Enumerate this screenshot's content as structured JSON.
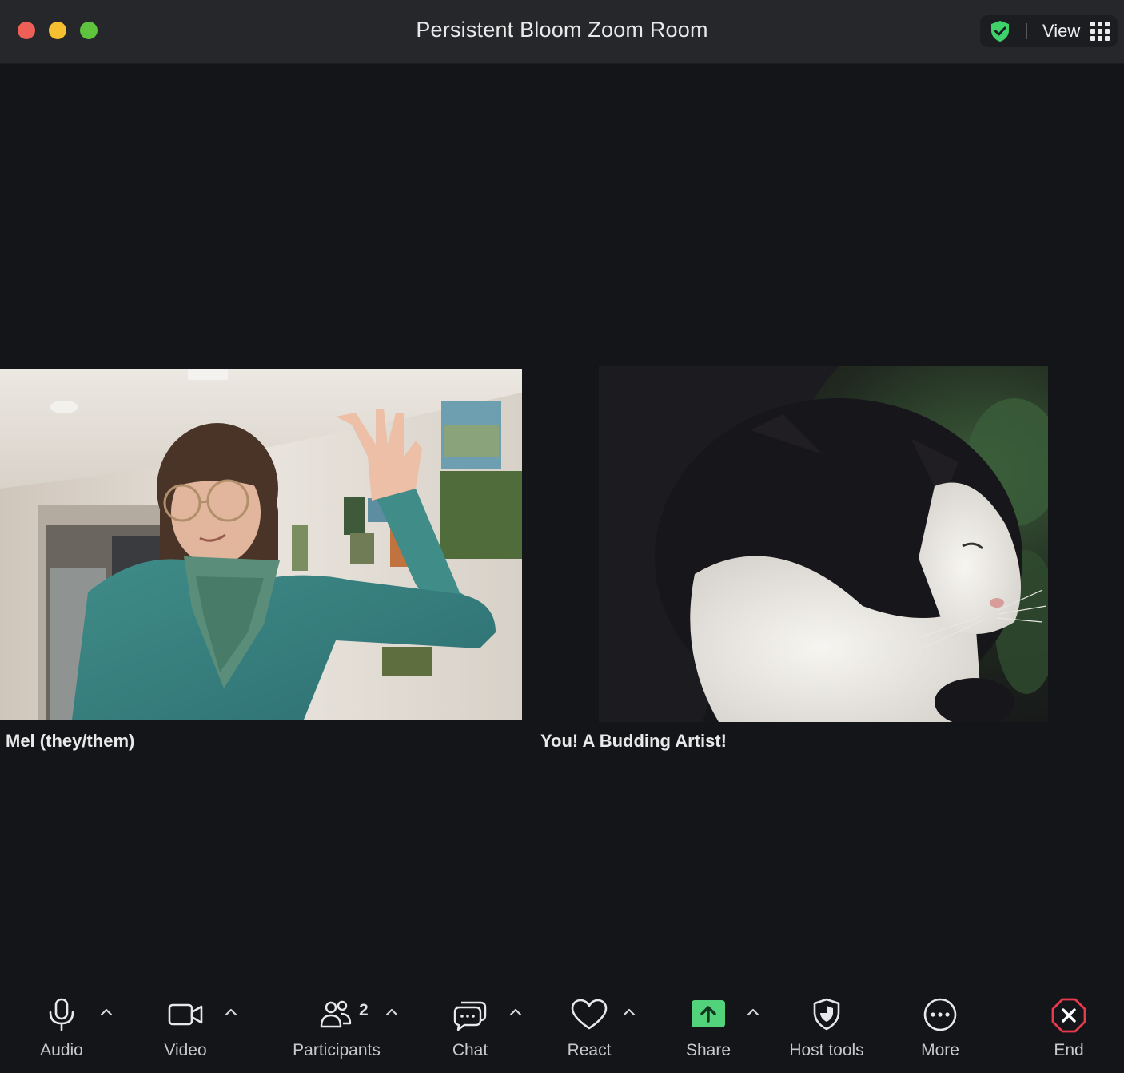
{
  "window": {
    "title": "Persistent Bloom Zoom Room"
  },
  "header": {
    "view_label": "View"
  },
  "participants": [
    {
      "name": "Mel (they/them)"
    },
    {
      "name": "You! A Budding Artist!"
    }
  ],
  "toolbar": {
    "audio_label": "Audio",
    "video_label": "Video",
    "participants_label": "Participants",
    "participants_count": "2",
    "chat_label": "Chat",
    "react_label": "React",
    "share_label": "Share",
    "host_tools_label": "Host tools",
    "more_label": "More",
    "end_label": "End"
  },
  "colors": {
    "background": "#141519",
    "titlebar": "#26272b",
    "share_accent": "#52d27a",
    "end_accent": "#e8394d",
    "security_green": "#3fd26b"
  }
}
